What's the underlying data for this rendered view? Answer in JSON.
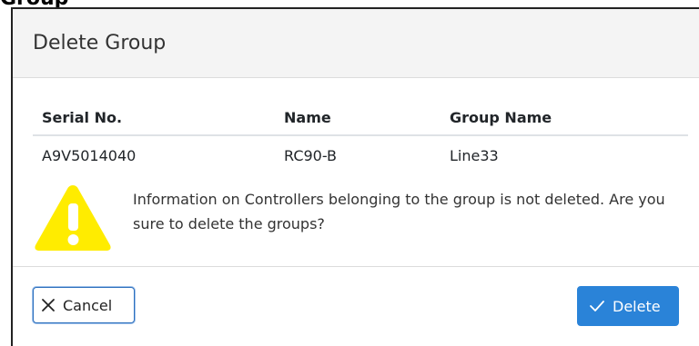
{
  "page": {
    "background_heading": "Group"
  },
  "dialog": {
    "title": "Delete Group",
    "table": {
      "headers": {
        "serial": "Serial No.",
        "name": "Name",
        "group_name": "Group Name"
      },
      "rows": [
        {
          "serial": "A9V5014040",
          "name": "RC90-B",
          "group_name": "Line33"
        }
      ]
    },
    "warning": {
      "icon": "warning-triangle-icon",
      "message": "Information on Controllers belonging to the group is not deleted. Are you sure to delete the groups?"
    },
    "buttons": {
      "cancel_label": "Cancel",
      "cancel_icon": "close-icon",
      "delete_label": "Delete",
      "delete_icon": "checkmark-icon"
    }
  },
  "colors": {
    "primary": "#2a83d8",
    "warning": "#ffec00",
    "header_bg": "#f4f4f4"
  }
}
